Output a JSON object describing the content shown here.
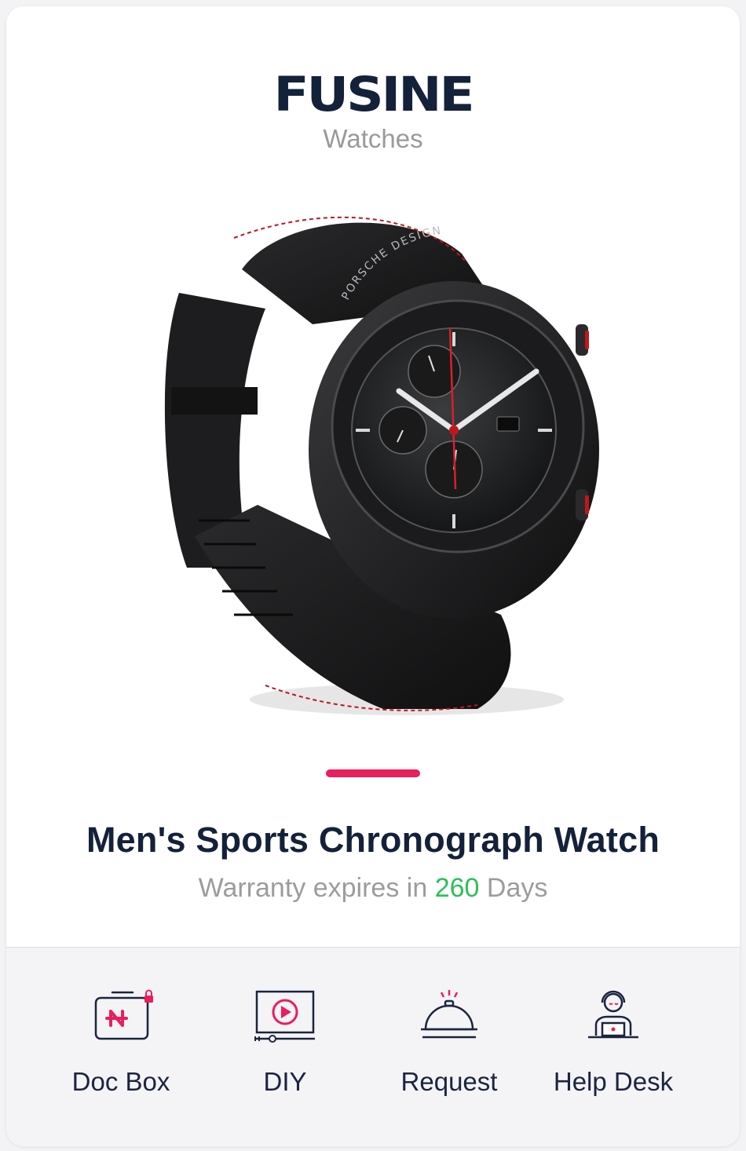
{
  "brand": {
    "logo": "FUSINE",
    "subtitle": "Watches"
  },
  "product": {
    "title": "Men's Sports Chronograph Watch",
    "warranty_prefix": "Warranty expires in",
    "warranty_days": "260",
    "warranty_suffix": "Days",
    "watch_brand_text": "PORSCHE DESIGN"
  },
  "colors": {
    "accent": "#ea1d5d",
    "days": "#2fbe58",
    "navy": "#14213a"
  },
  "actions": [
    {
      "label": "Doc Box",
      "icon": "doc-box-icon"
    },
    {
      "label": "DIY",
      "icon": "video-play-icon"
    },
    {
      "label": "Request",
      "icon": "service-bell-icon"
    },
    {
      "label": "Help Desk",
      "icon": "support-agent-icon"
    }
  ]
}
